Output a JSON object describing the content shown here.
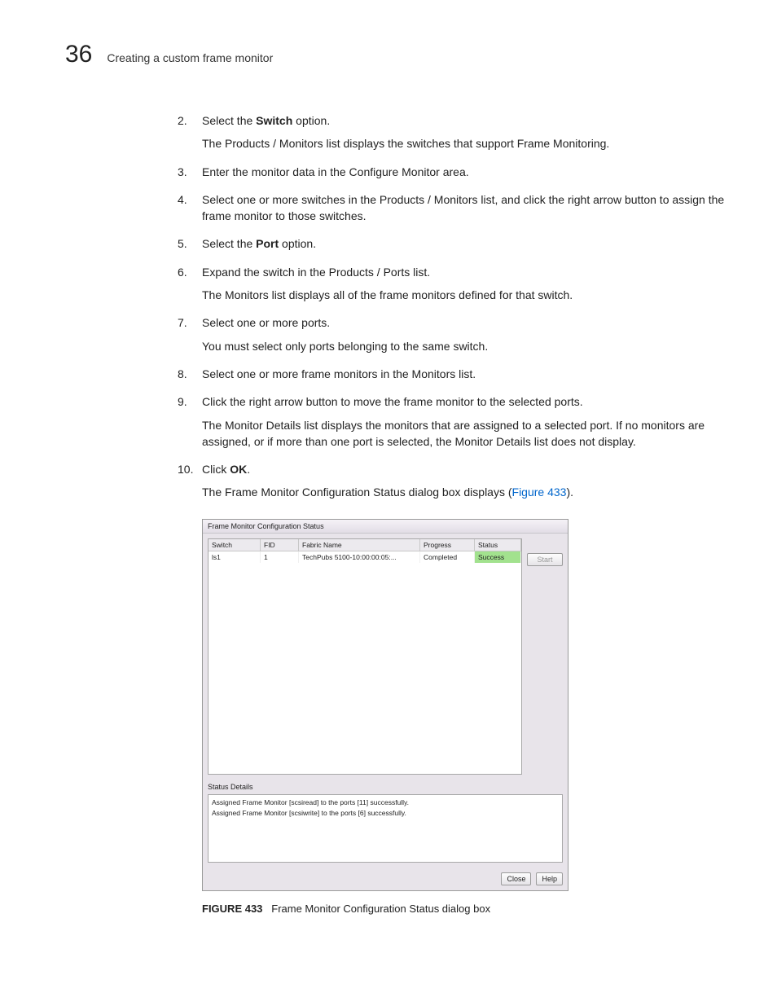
{
  "header": {
    "chapter_number": "36",
    "chapter_title": "Creating a custom frame monitor"
  },
  "steps": {
    "s2": {
      "pre": "Select the ",
      "bold": "Switch",
      "post": " option.",
      "body": "The Products / Monitors list displays the switches that support Frame Monitoring."
    },
    "s3": {
      "text": "Enter the monitor data in the Configure Monitor area."
    },
    "s4": {
      "text": "Select one or more switches in the Products / Monitors list, and click the right arrow button to assign the frame monitor to those switches."
    },
    "s5": {
      "pre": "Select the ",
      "bold": "Port",
      "post": " option."
    },
    "s6": {
      "text": "Expand the switch in the Products / Ports list.",
      "body": "The Monitors list displays all of the frame monitors defined for that switch."
    },
    "s7": {
      "text": "Select one or more ports.",
      "body": "You must select only ports belonging to the same switch."
    },
    "s8": {
      "text": "Select one or more frame monitors in the Monitors list."
    },
    "s9": {
      "text": "Click the right arrow button to move the frame monitor to the selected ports.",
      "body": "The Monitor Details list displays the monitors that are assigned to a selected port. If no monitors are assigned, or if more than one port is selected, the Monitor Details list does not display."
    },
    "s10": {
      "pre": "Click ",
      "bold": "OK",
      "post": ".",
      "body_pre": "The Frame Monitor Configuration Status dialog box displays (",
      "body_link": "Figure 433",
      "body_post": ")."
    }
  },
  "dialog": {
    "title": "Frame Monitor Configuration Status",
    "columns": {
      "c1": "Switch",
      "c2": "FID",
      "c3": "Fabric Name",
      "c4": "Progress",
      "c5": "Status"
    },
    "row": {
      "c1": "ls1",
      "c2": "1",
      "c3": "TechPubs 5100-10:00:00:05:...",
      "c4": "Completed",
      "c5": "Success"
    },
    "start": "Start",
    "status_details_label": "Status Details",
    "details_line1": "Assigned Frame Monitor [scsiread] to the ports [11] successfully.",
    "details_line2": "Assigned Frame Monitor [scsiwrite] to the ports [6] successfully.",
    "close": "Close",
    "help": "Help"
  },
  "figure": {
    "label": "FIGURE 433",
    "caption": "Frame Monitor Configuration Status dialog box"
  }
}
